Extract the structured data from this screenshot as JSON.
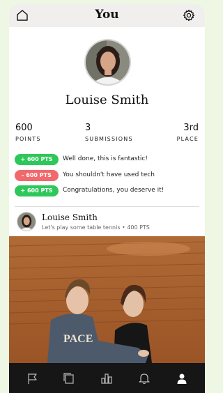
{
  "header": {
    "title": "You",
    "home_icon": "home-icon",
    "settings_icon": "gear-icon"
  },
  "profile": {
    "name": "Louise Smith",
    "stats": [
      {
        "value": "600",
        "label": "POINTS"
      },
      {
        "value": "3",
        "label": "SUBMISSIONS"
      },
      {
        "value": "3rd",
        "label": "PLACE"
      }
    ]
  },
  "activity": [
    {
      "badge": "+ 600 PTS",
      "text": "Well done, this is fantastic!",
      "color": "#2ec85a"
    },
    {
      "badge": "- 600 PTS",
      "text": "You shouldn't have used tech",
      "color": "#f0696c"
    },
    {
      "badge": "+ 600 PTS",
      "text": "Congratulations, you deserve it!",
      "color": "#2ec85a"
    }
  ],
  "post": {
    "author": "Louise Smith",
    "subtitle": "Let's play some table tennis • 400 PTS",
    "shirt_text": "PACE"
  },
  "nav": [
    {
      "icon": "flag-icon"
    },
    {
      "icon": "cards-icon"
    },
    {
      "icon": "bar-chart-icon"
    },
    {
      "icon": "bell-icon"
    },
    {
      "icon": "person-icon",
      "active": true
    }
  ],
  "colors": {
    "accent_green": "#2ec85a",
    "accent_red": "#f0696c",
    "nav_bg": "#161616",
    "page_bg": "#eef7e3"
  }
}
